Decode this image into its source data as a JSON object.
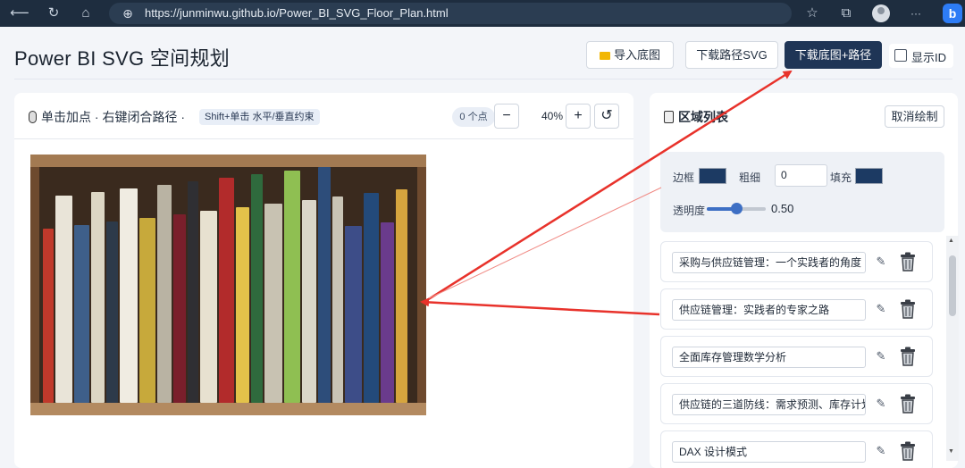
{
  "browser": {
    "url": "https://junminwu.github.io/Power_BI_SVG_Floor_Plan.html",
    "icons": [
      "back-icon",
      "refresh-icon",
      "home-icon",
      "globe-icon",
      "favorites-icon",
      "collections-icon",
      "profile-icon",
      "more-icon",
      "bing-icon"
    ],
    "more_label": "···",
    "bing_label": "b"
  },
  "header": {
    "title": "Power BI SVG 空间规划",
    "import_label": "导入底图",
    "download_svg_label": "下载路径SVG",
    "download_both_label": "下载底图+路径",
    "show_id_label": "显示ID",
    "show_id_checked": false
  },
  "canvas": {
    "hint": "单击加点 · 右键闭合路径 ·",
    "hint_tag": "Shift+单击 水平/垂直约束",
    "point_count": "0 个点",
    "zoom_out_label": "−",
    "zoom_level": "40%",
    "zoom_in_label": "+",
    "reset_label": "↺"
  },
  "regions": {
    "title": "区域列表",
    "cancel_label": "取消绘制",
    "border_label": "边框",
    "border_color": "#1c3a63",
    "weight_label": "粗细",
    "weight_value": "0",
    "fill_label": "填充",
    "fill_color": "#1c3a63",
    "opacity_label": "透明度",
    "opacity_value": "0.50",
    "items": [
      {
        "name": "采购与供应链管理：一个实践者的角度"
      },
      {
        "name": "供应链管理：实践者的专家之路"
      },
      {
        "name": "全面库存管理数学分析"
      },
      {
        "name": "供应链的三道防线：需求预测、库存计划、供应链执行"
      },
      {
        "name": "DAX 设计模式"
      }
    ]
  },
  "colors": {
    "browser_bar": "#1e2d3f",
    "primary_button": "#1f3556",
    "annotation_arrow": "#e8322b"
  }
}
